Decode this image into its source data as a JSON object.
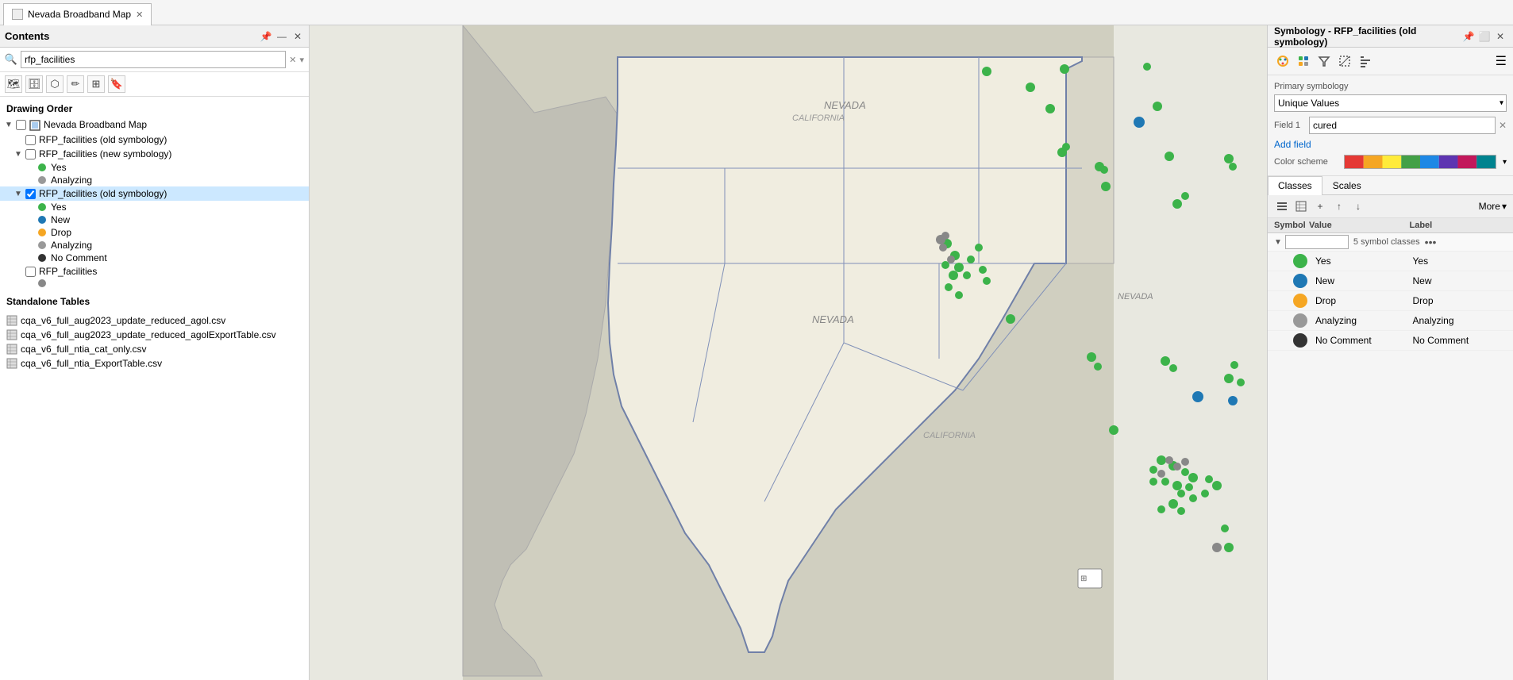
{
  "window": {
    "title": "Nevada Broadband Map",
    "tab_label": "Nevada Broadband Map"
  },
  "contents": {
    "title": "Contents",
    "search_placeholder": "rfp_facilities",
    "search_value": "rfp_facilities",
    "drawing_order_label": "Drawing Order",
    "layers": [
      {
        "id": "nevada-broadband-map",
        "name": "Nevada Broadband Map",
        "checked": false,
        "indented": false,
        "type": "group",
        "icon": "map"
      },
      {
        "id": "rfp-old",
        "name": "RFP_facilities (old symbology)",
        "checked": false,
        "indented": true,
        "type": "layer"
      },
      {
        "id": "rfp-new",
        "name": "RFP_facilities (new symbology)",
        "checked": false,
        "indented": true,
        "type": "layer"
      }
    ],
    "rfp_new_legend": [
      {
        "color": "#3cb34a",
        "label": "Yes"
      },
      {
        "color": "#666666",
        "label": "Analyzing"
      }
    ],
    "rfp_old_selected": true,
    "rfp_old_legend": [
      {
        "color": "#3cb34a",
        "label": "Yes"
      },
      {
        "color": "#1f78b4",
        "label": "New"
      },
      {
        "color": "#f5a623",
        "label": "Drop"
      },
      {
        "color": "#999999",
        "label": "Analyzing"
      },
      {
        "color": "#333333",
        "label": "No Comment"
      }
    ],
    "rfp_facilities_layer": {
      "name": "RFP_facilities",
      "checked": false
    },
    "standalone_tables_label": "Standalone Tables",
    "tables": [
      "cqa_v6_full_aug2023_update_reduced_agol.csv",
      "cqa_v6_full_aug2023_update_reduced_agolExportTable.csv",
      "cqa_v6_full_ntia_cat_only.csv",
      "cqa_v6_full_ntia_ExportTable.csv"
    ]
  },
  "symbology": {
    "title": "Symbology - RFP_facilities (old symbology)",
    "primary_symbology_label": "Primary symbology",
    "type": "Unique Values",
    "field1_label": "Field 1",
    "field1_value": "cured",
    "add_field_label": "Add field",
    "color_scheme_label": "Color scheme",
    "tabs": [
      "Classes",
      "Scales"
    ],
    "active_tab": "Classes",
    "more_label": "More",
    "symbol_col": "Symbol",
    "value_col": "Value",
    "label_col": "Label",
    "class_count": "5 symbol classes",
    "classes": [
      {
        "color": "#3cb34a",
        "value": "Yes",
        "label": "Yes"
      },
      {
        "color": "#1f78b4",
        "value": "New",
        "label": "New"
      },
      {
        "color": "#f5a623",
        "value": "Drop",
        "label": "Drop"
      },
      {
        "color": "#999999",
        "value": "Analyzing",
        "label": "Analyzing"
      },
      {
        "color": "#333333",
        "value": "No Comment",
        "label": "No Comment"
      }
    ]
  },
  "map": {
    "background_land": "#e0ddd0",
    "background_water": "#c8d8e8",
    "nevada_fill": "#f5f3ee",
    "nevada_border": "#7080a8"
  }
}
